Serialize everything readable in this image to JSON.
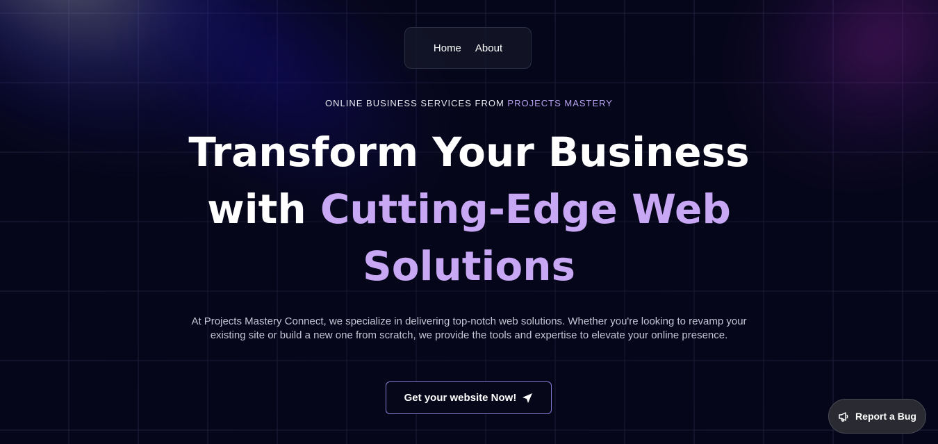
{
  "nav": {
    "items": [
      {
        "label": "Home"
      },
      {
        "label": "About"
      }
    ]
  },
  "hero": {
    "eyebrow_prefix": "ONLINE BUSINESS SERVICES FROM",
    "eyebrow_accent": "PROJECTS MASTERY",
    "headline_line1": "Transform Your Business",
    "headline_with": "with",
    "headline_accent": "Cutting-Edge Web Solutions",
    "description": "At Projects Mastery Connect, we specialize in delivering top-notch web solutions. Whether you're looking to revamp your existing site or build a new one from scratch, we provide the tools and expertise to elevate your online presence.",
    "cta_label": "Get your website Now!",
    "cta_icon": "send-icon"
  },
  "report_bug": {
    "label": "Report a Bug",
    "icon": "megaphone-icon"
  },
  "colors": {
    "background": "#06061a",
    "accent": "#c8a8f5",
    "eyebrow_accent": "#b8a3f2",
    "cta_border": "#8a7ad6"
  }
}
